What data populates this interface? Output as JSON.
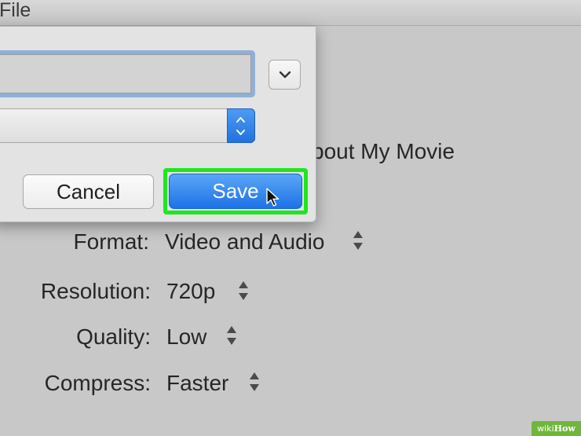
{
  "window": {
    "title": "File"
  },
  "sheet": {
    "name_value": "",
    "location_value": "",
    "cancel_label": "Cancel",
    "save_label": "Save"
  },
  "background": {
    "partial_text": "bout My Movie",
    "settings": [
      {
        "label": "Format:",
        "value": "Video and Audio"
      },
      {
        "label": "Resolution:",
        "value": "720p"
      },
      {
        "label": "Quality:",
        "value": "Low"
      },
      {
        "label": "Compress:",
        "value": "Faster"
      }
    ]
  },
  "watermark": {
    "prefix": "wiki",
    "suffix": "How"
  },
  "colors": {
    "accent_blue": "#1d72e6",
    "highlight_green": "#1fe61f",
    "background": "#c8c8c8"
  },
  "icons": {
    "expand": "chevron-down-icon",
    "popup": "up-down-arrows-icon",
    "stepper": "stepper-icon",
    "cursor": "mouse-pointer-icon"
  }
}
